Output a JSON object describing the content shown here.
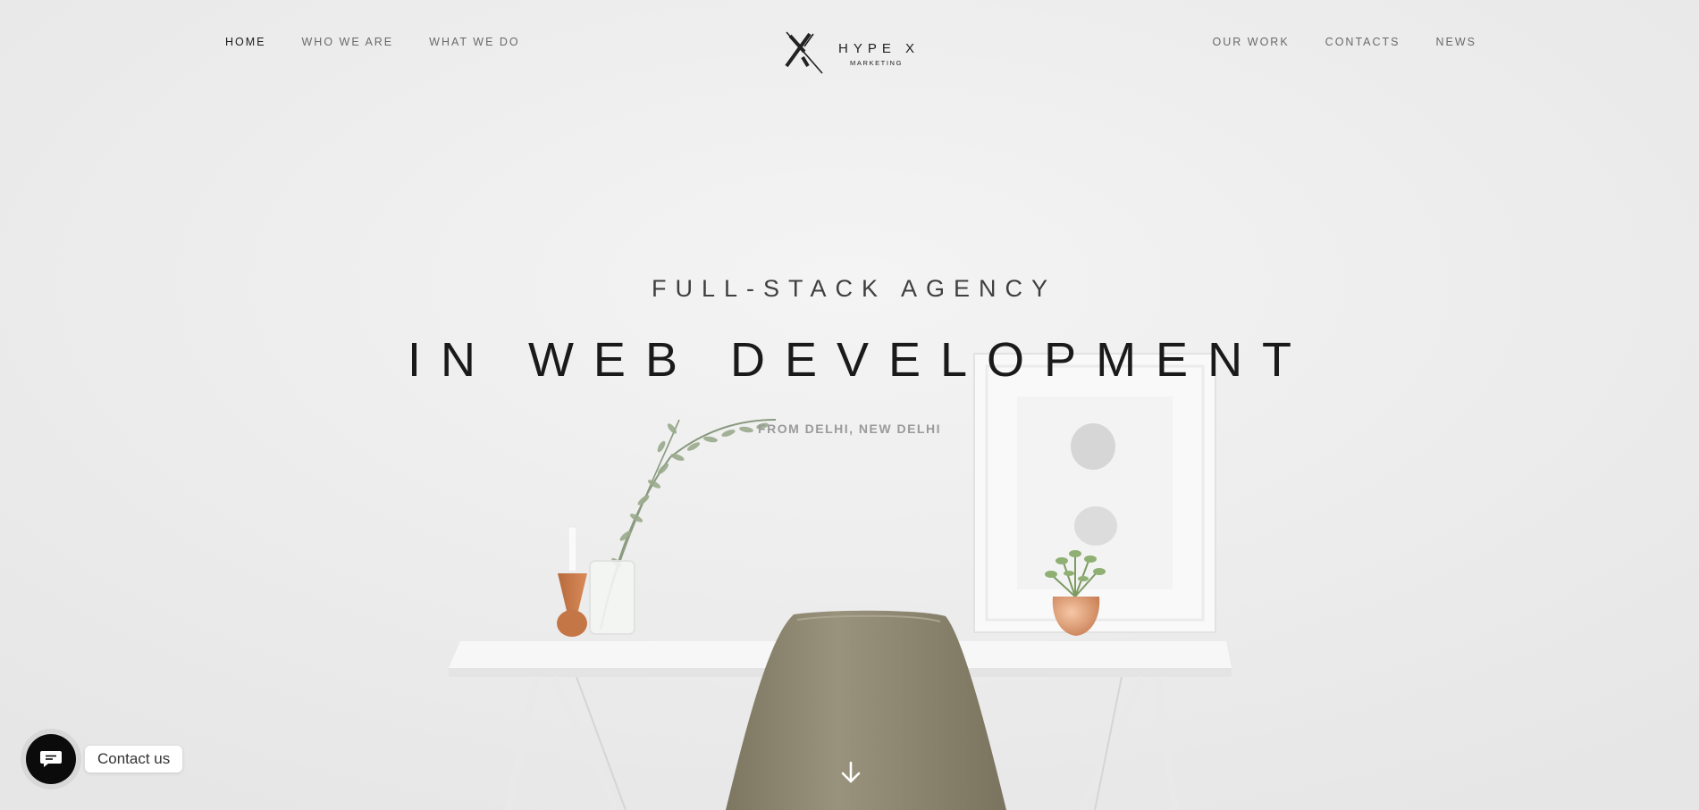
{
  "nav": {
    "left": [
      {
        "label": "HOME",
        "active": true
      },
      {
        "label": "WHO WE ARE",
        "active": false
      },
      {
        "label": "WHAT WE DO",
        "active": false
      }
    ],
    "right": [
      {
        "label": "OUR WORK"
      },
      {
        "label": "CONTACTS"
      },
      {
        "label": "NEWS"
      }
    ]
  },
  "brand": {
    "name": "HYPE X",
    "sub": "MARKETING",
    "icon": "x-logo-icon"
  },
  "hero": {
    "kicker": "FULL-STACK AGENCY",
    "headline": "IN WEB DEVELOPMENT",
    "location": "FROM DELHI, NEW DELHI"
  },
  "scroll": {
    "icon": "arrow-down-icon"
  },
  "contact": {
    "label": "Contact us",
    "icon": "chat-bubble-icon"
  },
  "colors": {
    "background": "#ededed",
    "text_dark": "#1a1a1a",
    "chair": "#8c8670"
  }
}
